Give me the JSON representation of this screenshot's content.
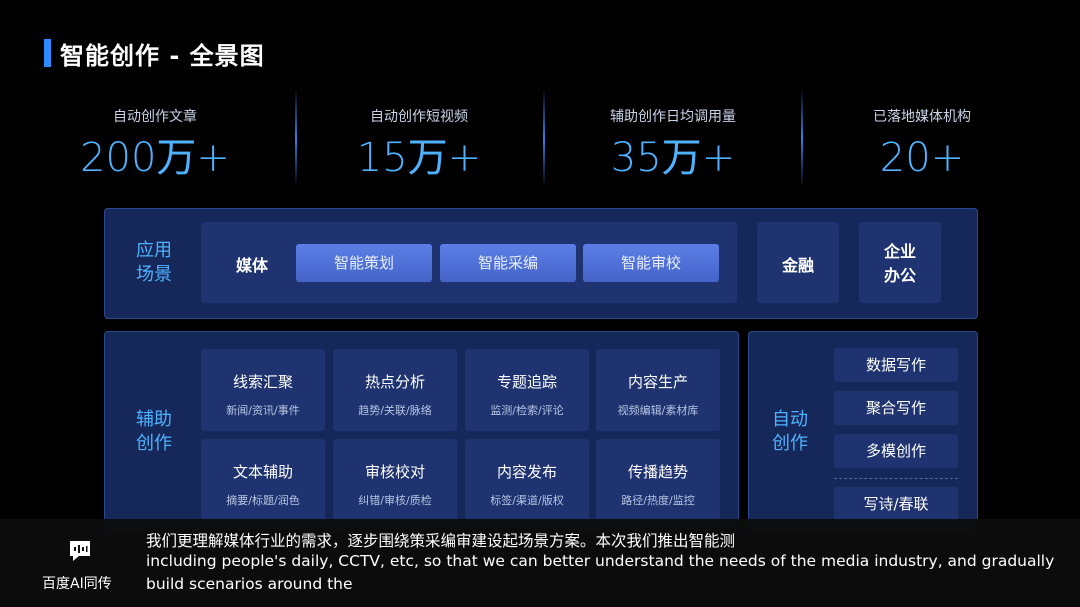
{
  "title": "智能创作 - 全景图",
  "stats": [
    {
      "label": "自动创作文章",
      "num": "200万",
      "plus": "+"
    },
    {
      "label": "自动创作短视频",
      "num": "15万",
      "plus": "+"
    },
    {
      "label": "辅助创作日均调用量",
      "num": "35万",
      "plus": "+"
    },
    {
      "label": "已落地媒体机构",
      "num": "20",
      "plus": "+"
    }
  ],
  "scenes": {
    "label_line1": "应用",
    "label_line2": "场景",
    "media": "媒体",
    "chips": [
      "智能策划",
      "智能采编",
      "智能审校"
    ],
    "finance": "金融",
    "office_line1": "企业",
    "office_line2": "办公"
  },
  "assist": {
    "label_line1": "辅助",
    "label_line2": "创作",
    "cells": [
      {
        "title": "线索汇聚",
        "sub": "新闻/资讯/事件"
      },
      {
        "title": "热点分析",
        "sub": "趋势/关联/脉络"
      },
      {
        "title": "专题追踪",
        "sub": "监测/检索/评论"
      },
      {
        "title": "内容生产",
        "sub": "视频编辑/素材库"
      },
      {
        "title": "文本辅助",
        "sub": "摘要/标题/润色"
      },
      {
        "title": "审核校对",
        "sub": "纠错/审核/质检"
      },
      {
        "title": "内容发布",
        "sub": "标签/渠道/版权"
      },
      {
        "title": "传播趋势",
        "sub": "路径/热度/监控"
      }
    ]
  },
  "auto": {
    "label_line1": "自动",
    "label_line2": "创作",
    "items": [
      "数据写作",
      "聚合写作",
      "多模创作",
      "写诗/春联"
    ]
  },
  "subtitle": {
    "logo_text": "百度AI同传",
    "line1": "我们更理解媒体行业的需求，逐步围绕策采编审建设起场景方案。本次我们推出智能测",
    "line2": "including people's daily, CCTV, etc, so that we can better understand the needs of the media industry, and gradually",
    "line3": "build scenarios around the"
  }
}
